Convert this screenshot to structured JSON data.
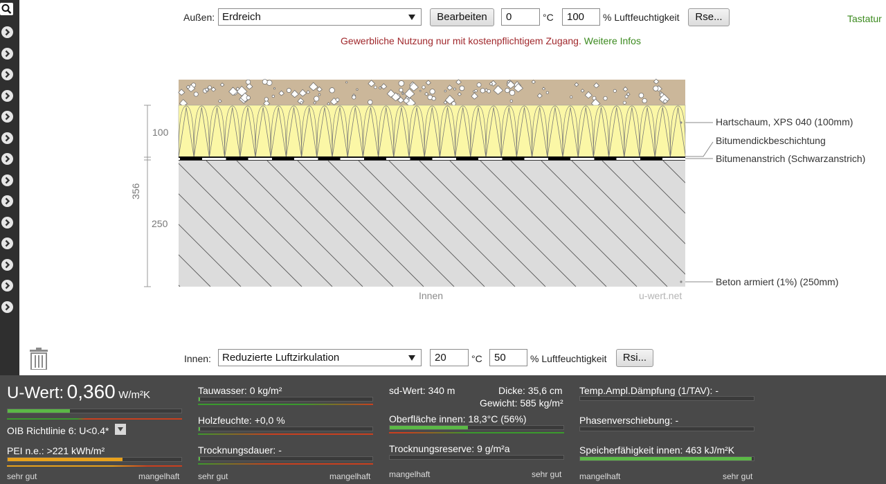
{
  "toolbar_top": {
    "outside_label": "Außen:",
    "outside_select": "Erdreich",
    "edit_button": "Bearbeiten",
    "temperature": "0",
    "temp_unit": "°C",
    "humidity": "100",
    "humidity_unit": "% Luftfeuchtigkeit",
    "rse_button": "Rse...",
    "keyboard_link": "Tastatur"
  },
  "notice": {
    "text": "Gewerbliche Nutzung nur mit kostenpflichtigem Zugang.",
    "link": "Weitere Infos"
  },
  "construction": {
    "dimensions": {
      "total": "356",
      "upper": "100",
      "lower": "250"
    },
    "layers": [
      {
        "name": "Hartschaum, XPS 040 (100mm)",
        "color": "#fbf7a6"
      },
      {
        "name": "Bitumendickbeschichtung",
        "color": "#000000"
      },
      {
        "name": "Bitumenanstrich (Schwarzanstrich)",
        "color": "#000000"
      },
      {
        "name": "Beton armiert (1%) (250mm)",
        "color": "#dcdcdc"
      }
    ],
    "soil_color": "#cbb79a",
    "inside_label": "Innen",
    "watermark": "u-wert.net"
  },
  "toolbar_bottom": {
    "inside_label": "Innen:",
    "inside_select": "Reduzierte Luftzirkulation",
    "temperature": "20",
    "temp_unit": "°C",
    "humidity": "50",
    "humidity_unit": "% Luftfeuchtigkeit",
    "rsi_button": "Rsi..."
  },
  "results": {
    "u_value_label": "U-Wert:",
    "u_value": "0,360",
    "u_unit": "W/m²K",
    "u_bar": 0.36,
    "oib_label": "OIB Richtlinie 6: U<0.4*",
    "pei_label": "PEI n.e.: >221 kWh/m²",
    "pei_bar": 0.66,
    "col1_scale": {
      "left": "sehr gut",
      "right": "mangelhaft"
    },
    "tauwasser": "Tauwasser: 0 kg/m²",
    "holzfeuchte": "Holzfeuchte: +0,0 %",
    "trocknungsdauer": "Trocknungsdauer: -",
    "col2_scale": {
      "left": "sehr gut",
      "right": "mangelhaft"
    },
    "sd_wert": "sd-Wert: 340 m",
    "dicke": "Dicke: 35,6 cm",
    "gewicht": "Gewicht: 585 kg/m²",
    "oberflaeche": "Oberfläche innen: 18,3°C (56%)",
    "oberflaeche_bar": 0.45,
    "trocknungsreserve": "Trocknungsreserve: 9 g/m²a",
    "col3_scale": {
      "left": "mangelhaft",
      "right": "sehr gut"
    },
    "temp_ampl": "Temp.Ampl.Dämpfung (1/TAV): -",
    "phasen": "Phasenverschiebung: -",
    "speicher": "Speicherfähigkeit innen: 463 kJ/m²K",
    "speicher_bar": 0.99,
    "col4_scale": {
      "left": "mangelhaft",
      "right": "sehr gut"
    }
  }
}
